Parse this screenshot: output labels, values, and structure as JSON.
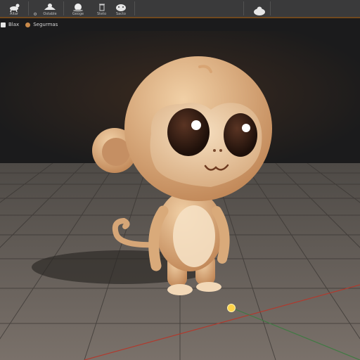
{
  "toolbar": {
    "tools": [
      {
        "label": "Altar"
      },
      {
        "label": "Ostable"
      },
      {
        "label": "Geoge"
      },
      {
        "label": "Steto"
      },
      {
        "label": "Sacto"
      }
    ]
  },
  "status": {
    "mode_label": "Blax",
    "scene_label": "Segurmas"
  },
  "colors": {
    "toolbar_bg": "#3a3a3b",
    "accent_orange": "#b36b1e",
    "viewport_bg": "#1b1b1c",
    "floor": "#6e6762",
    "axis_red": "#b03a2e",
    "axis_green": "#3f7a42",
    "pivot": "#ffd34a"
  }
}
